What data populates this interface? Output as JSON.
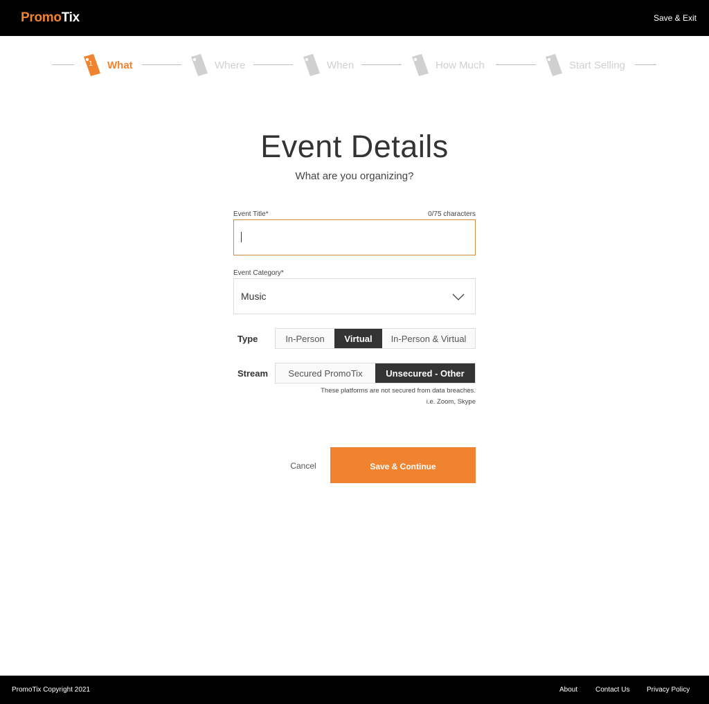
{
  "header": {
    "logo_part1": "Promo",
    "logo_part2": "Tix",
    "save_exit_label": "Save & Exit"
  },
  "stepper": {
    "steps": [
      {
        "number": "1",
        "label": "What",
        "active": true
      },
      {
        "number": "",
        "label": "Where",
        "active": false
      },
      {
        "number": "",
        "label": "When",
        "active": false
      },
      {
        "number": "",
        "label": "How Much",
        "active": false
      },
      {
        "number": "",
        "label": "Start Selling",
        "active": false
      }
    ]
  },
  "page": {
    "title": "Event Details",
    "subtitle": "What are you organizing?"
  },
  "form": {
    "event_title": {
      "label": "Event Title*",
      "char_count": "0/75 characters",
      "value": ""
    },
    "event_category": {
      "label": "Event Category*",
      "selected": "Music"
    },
    "type": {
      "label": "Type",
      "options": [
        "In-Person",
        "Virtual",
        "In-Person & Virtual"
      ],
      "selected": "Virtual"
    },
    "stream": {
      "label": "Stream",
      "options": [
        "Secured PromoTix",
        "Unsecured - Other"
      ],
      "selected": "Unsecured - Other",
      "hint_line1": "These platforms are not secured from data breaches.",
      "hint_line2": "i.e. Zoom, Skype"
    },
    "cancel_label": "Cancel",
    "save_label": "Save & Continue"
  },
  "footer": {
    "copyright": "PromoTix Copyright 2021",
    "links": [
      "About",
      "Contact Us",
      "Privacy Policy"
    ]
  },
  "colors": {
    "accent": "#f0832f",
    "dark": "#333333",
    "header_bg": "#000000",
    "inactive_step": "#d0d0d0"
  }
}
